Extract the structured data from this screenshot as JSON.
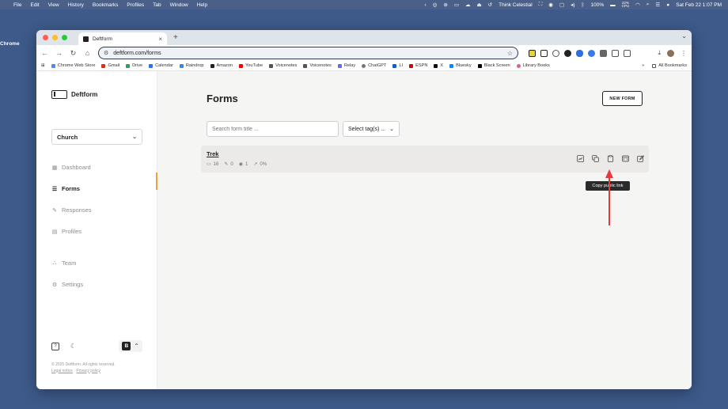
{
  "menubar": {
    "app": "Chrome",
    "items": [
      "File",
      "Edit",
      "View",
      "History",
      "Bookmarks",
      "Profiles",
      "Tab",
      "Window",
      "Help"
    ],
    "now_playing": "Think Celestial",
    "battery": "100%",
    "cpu": "22%",
    "cpu_label": "CPU",
    "datetime": "Sat Feb 22  1:07 PM"
  },
  "browser": {
    "tab_title": "Deftform",
    "url": "deftform.com/forms",
    "bookmarks": [
      "Chrome Web Store",
      "Gmail",
      "Drive",
      "Calendar",
      "Raindrop",
      "Amazon",
      "YouTube",
      "Voicenotes",
      "Voicenotes",
      "Relay",
      "ChatGPT",
      "LI",
      "ESPN",
      "X",
      "Bluesky",
      "Black Screen",
      "Library Books"
    ],
    "all_bookmarks": "All Bookmarks",
    "more": "»"
  },
  "sidebar": {
    "brand": "Deftform",
    "workspace": "Church",
    "items": [
      {
        "label": "Dashboard"
      },
      {
        "label": "Forms"
      },
      {
        "label": "Responses"
      },
      {
        "label": "Profiles"
      },
      {
        "label": "Team"
      },
      {
        "label": "Settings"
      }
    ],
    "user_initial": "B",
    "copyright": "© 2025 Deftform. All rights reserved.",
    "legal": "Legal notice",
    "separator": " · ",
    "privacy": "Privacy policy"
  },
  "main": {
    "title": "Forms",
    "new_form": "NEW FORM",
    "search_placeholder": "Search form title ...",
    "tags_placeholder": "Select tag(s) ...",
    "forms": [
      {
        "name": "Trek",
        "fields": "16",
        "responses": "0",
        "views": "1",
        "conversion": "0%"
      }
    ],
    "tooltip": "Copy public link"
  },
  "colors": {
    "desktop": "#3d5a8a",
    "accent": "#f0a040",
    "chat": "#ef5a24",
    "annotation": "#e8383b"
  }
}
